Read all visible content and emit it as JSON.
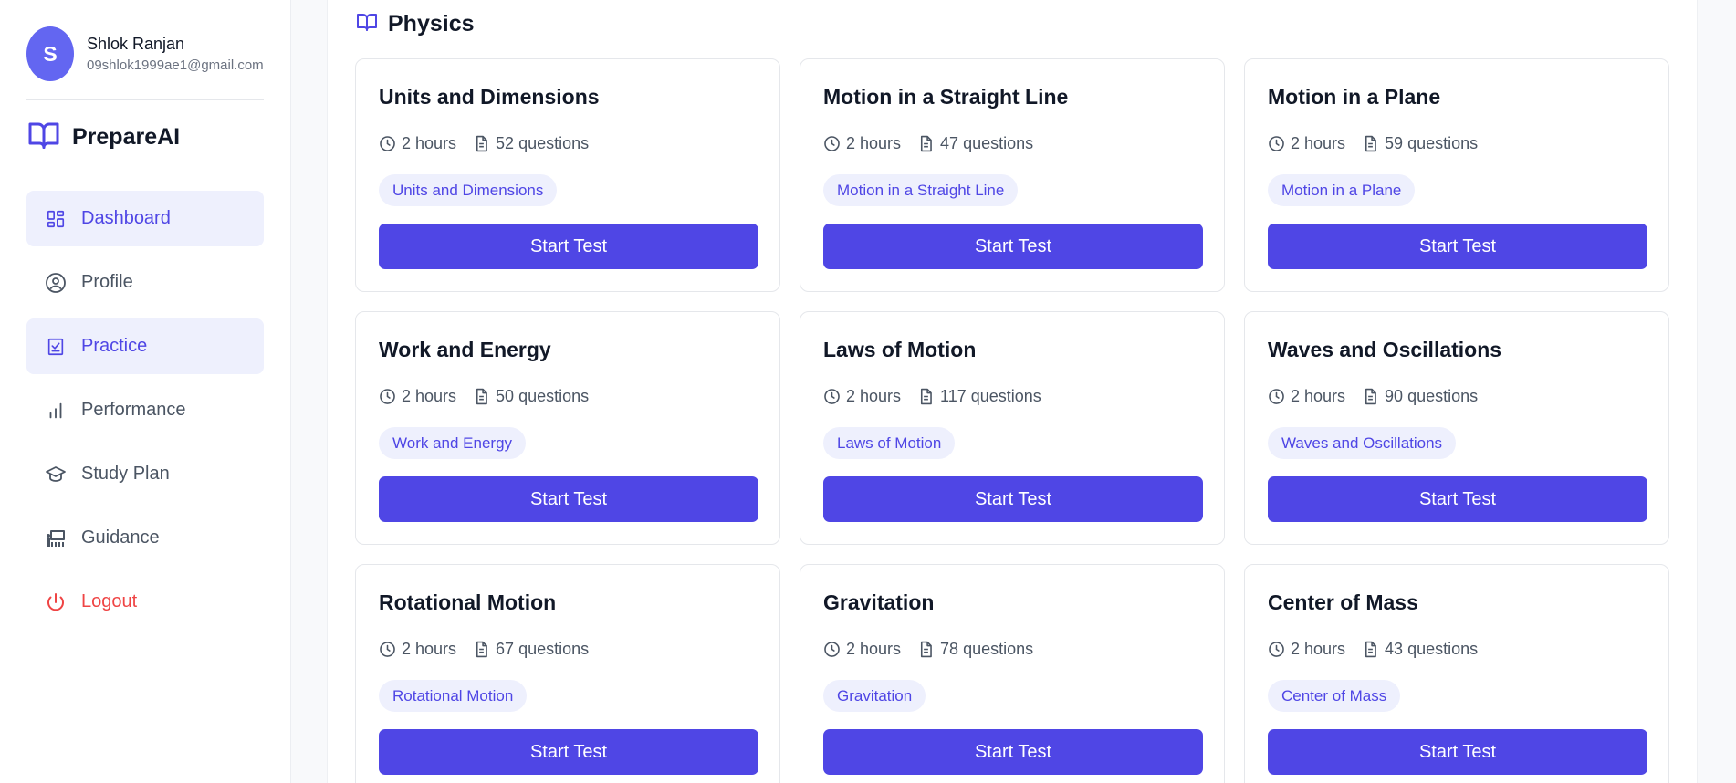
{
  "user": {
    "initial": "S",
    "name": "Shlok Ranjan",
    "email": "09shlok1999ae1@gmail.com"
  },
  "brand": {
    "name": "PrepareAI",
    "icon": "open-book-icon"
  },
  "nav": [
    {
      "label": "Dashboard",
      "icon": "dashboard-icon",
      "active": true
    },
    {
      "label": "Profile",
      "icon": "user-circle-icon",
      "active": false
    },
    {
      "label": "Practice",
      "icon": "clipboard-check-icon",
      "active": true
    },
    {
      "label": "Performance",
      "icon": "bar-chart-icon",
      "active": false
    },
    {
      "label": "Study Plan",
      "icon": "graduation-cap-icon",
      "active": false
    },
    {
      "label": "Guidance",
      "icon": "presentation-icon",
      "active": false
    },
    {
      "label": "Logout",
      "icon": "power-icon",
      "active": false
    }
  ],
  "section": {
    "title": "Physics",
    "icon": "open-book-icon"
  },
  "cards": [
    {
      "title": "Units and Dimensions",
      "duration": "2 hours",
      "questions": "52 questions",
      "tag": "Units and Dimensions",
      "button": "Start Test"
    },
    {
      "title": "Motion in a Straight Line",
      "duration": "2 hours",
      "questions": "47 questions",
      "tag": "Motion in a Straight Line",
      "button": "Start Test"
    },
    {
      "title": "Motion in a Plane",
      "duration": "2 hours",
      "questions": "59 questions",
      "tag": "Motion in a Plane",
      "button": "Start Test"
    },
    {
      "title": "Work and Energy",
      "duration": "2 hours",
      "questions": "50 questions",
      "tag": "Work and Energy",
      "button": "Start Test"
    },
    {
      "title": "Laws of Motion",
      "duration": "2 hours",
      "questions": "117 questions",
      "tag": "Laws of Motion",
      "button": "Start Test"
    },
    {
      "title": "Waves and Oscillations",
      "duration": "2 hours",
      "questions": "90 questions",
      "tag": "Waves and Oscillations",
      "button": "Start Test"
    },
    {
      "title": "Rotational Motion",
      "duration": "2 hours",
      "questions": "67 questions",
      "tag": "Rotational Motion",
      "button": "Start Test"
    },
    {
      "title": "Gravitation",
      "duration": "2 hours",
      "questions": "78 questions",
      "tag": "Gravitation",
      "button": "Start Test"
    },
    {
      "title": "Center of Mass",
      "duration": "2 hours",
      "questions": "43 questions",
      "tag": "Center of Mass",
      "button": "Start Test"
    }
  ],
  "colors": {
    "accent": "#4f46e5",
    "avatar": "#6366f1",
    "active_bg": "#eef0fd",
    "logout": "#ef4444"
  }
}
